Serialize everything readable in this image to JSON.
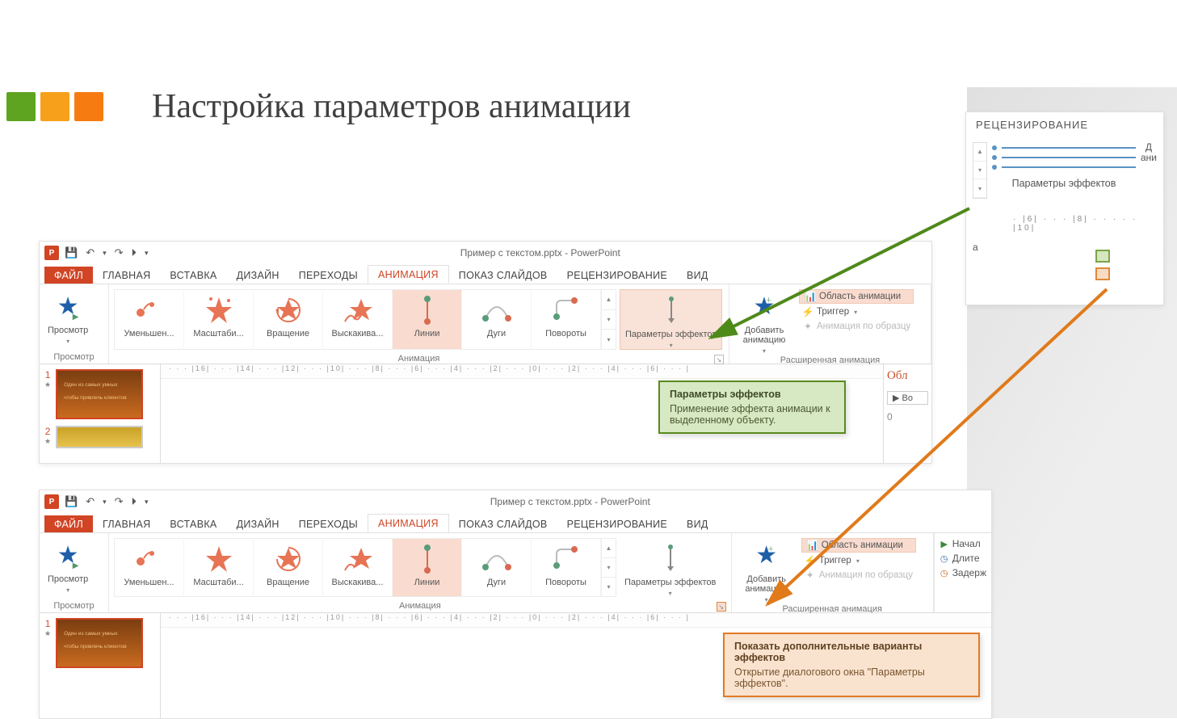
{
  "page": {
    "title": "Настройка параметров анимации"
  },
  "app": {
    "badge": "P",
    "window_title": "Пример с текстом.pptx - PowerPoint",
    "qat": {
      "save": "💾",
      "undo": "↶",
      "redo": "↷",
      "start": "⏵",
      "dd": "▾"
    }
  },
  "tabs": [
    "ФАЙЛ",
    "ГЛАВНАЯ",
    "ВСТАВКА",
    "ДИЗАЙН",
    "ПЕРЕХОДЫ",
    "АНИМАЦИЯ",
    "ПОКАЗ СЛАЙДОВ",
    "РЕЦЕНЗИРОВАНИЕ",
    "ВИД"
  ],
  "active_tab": "АНИМАЦИЯ",
  "ribbon": {
    "preview": {
      "label": "Просмотр",
      "group": "Просмотр"
    },
    "gallery_group": "Анимация",
    "gallery": [
      {
        "name": "reduce",
        "label": "Уменьшен..."
      },
      {
        "name": "scale",
        "label": "Масштаби..."
      },
      {
        "name": "spin",
        "label": "Вращение"
      },
      {
        "name": "bounce",
        "label": "Выскакива..."
      },
      {
        "name": "lines",
        "label": "Линии",
        "selected": true
      },
      {
        "name": "arcs",
        "label": "Дуги"
      },
      {
        "name": "turns",
        "label": "Повороты"
      }
    ],
    "effect_options": {
      "label": "Параметры эффектов"
    },
    "add_anim": {
      "label": "Добавить анимацию"
    },
    "adv_group": "Расширенная анимация",
    "pane": "Область анимации",
    "trigger": "Триггер",
    "painter": "Анимация по образцу",
    "timing": {
      "start": "Начал",
      "duration": "Длите",
      "delay": "Задерж"
    }
  },
  "ruler": "· · · |16| · · · |14| · · · |12| · · · |10| · · · |8| · · · |6| · · · |4| · · · |2| · · · |0| · · · |2| · · · |4| · · · |6| · · · |",
  "thumbs": {
    "n1": "1",
    "n2": "2",
    "star": "★",
    "slide_text1": "Один из самых умных",
    "slide_text2": "чтобы привлечь клиентов"
  },
  "anim_panel": {
    "header": "Обл",
    "btn": "▶  Во",
    "zero": "0"
  },
  "tooltip_green": {
    "title": "Параметры эффектов",
    "body": "Применение эффекта анимации к выделенному объекту."
  },
  "tooltip_orange": {
    "title": "Показать дополнительные варианты эффектов",
    "body": "Открытие диалогового окна \"Параметры эффектов\"."
  },
  "shot3": {
    "tab": "РЕЦЕНЗИРОВАНИЕ",
    "label": "Параметры эффектов",
    "right": "Д\nани",
    "left": "а",
    "ruler": "· |6| · · · |8| · · · · · |10|",
    "spin": [
      "▲",
      "▾",
      "▾"
    ]
  },
  "glyphs": {
    "up": "▲",
    "down": "▾",
    "more": "▾",
    "launcher": "↘",
    "play": "▶",
    "clock": "◷",
    "trigger": "⚡",
    "painter": "✦",
    "dot": "•"
  }
}
